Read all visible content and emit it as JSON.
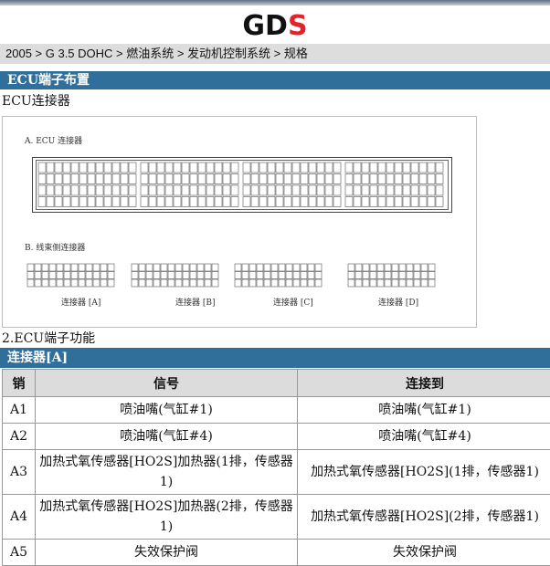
{
  "header": {
    "logo_text": "GDS",
    "brand_color": "#e3232b"
  },
  "breadcrumb": "2005 > G 3.5 DOHC > 燃油系统 > 发动机控制系统 > 规格",
  "section1": {
    "title": "ECU端子布置",
    "subtitle": "ECU连接器"
  },
  "figure": {
    "caption_a": "A. ECU 连接器",
    "caption_b": "B. 线束侧连接器",
    "connector_labels": [
      "连接器 [A]",
      "连接器 [B]",
      "连接器 [C]",
      "连接器 [D]"
    ]
  },
  "section2": {
    "title": "2.ECU端子功能"
  },
  "table": {
    "title": "连接器[A]",
    "headers": [
      "销",
      "信号",
      "连接到"
    ],
    "rows": [
      {
        "pin": "A1",
        "signal": "喷油嘴(气缸#1)",
        "connect": "喷油嘴(气缸#1)"
      },
      {
        "pin": "A2",
        "signal": "喷油嘴(气缸#4)",
        "connect": "喷油嘴(气缸#4)"
      },
      {
        "pin": "A3",
        "signal": "加热式氧传感器[HO2S]加热器(1排，传感器1)",
        "connect": "加热式氧传感器[HO2S](1排，传感器1)"
      },
      {
        "pin": "A4",
        "signal": "加热式氧传感器[HO2S]加热器(2排，传感器1)",
        "connect": "加热式氧传感器[HO2S](2排，传感器1)"
      },
      {
        "pin": "A5",
        "signal": "失效保护阀",
        "connect": "失效保护阀"
      }
    ]
  }
}
